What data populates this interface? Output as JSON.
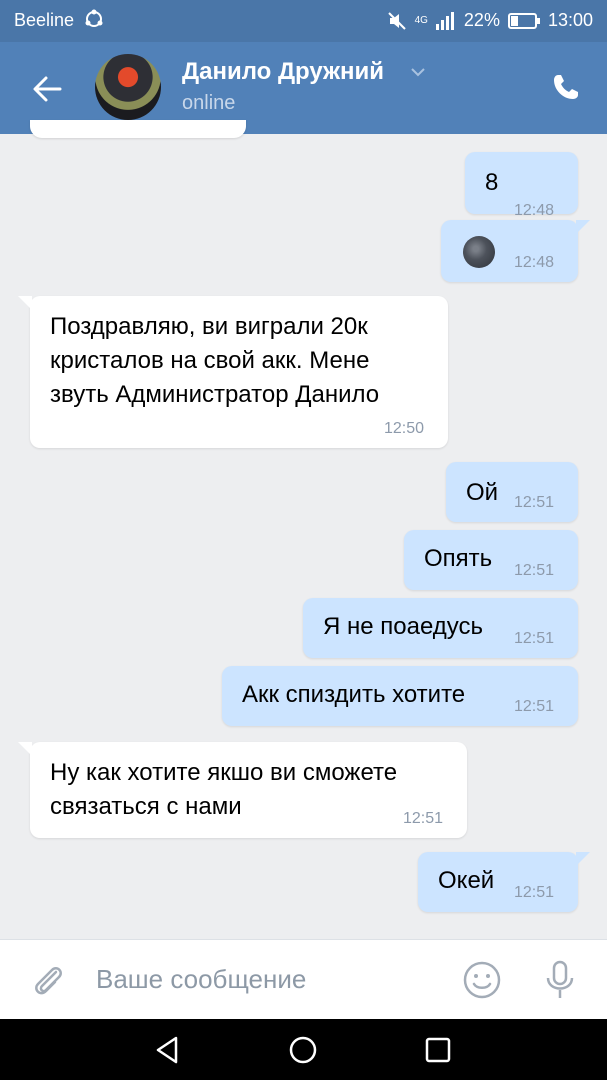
{
  "status_bar": {
    "carrier": "Beeline",
    "network": "4G",
    "battery": "22%",
    "time": "13:00"
  },
  "header": {
    "contact_name": "Данило Дружний",
    "presence": "online"
  },
  "messages": [
    {
      "direction": "out",
      "text": "8",
      "time": "12:48"
    },
    {
      "direction": "out",
      "text": "",
      "emoji": "new-moon-face",
      "time": "12:48"
    },
    {
      "direction": "in",
      "text": "Поздравляю, ви виграли 20к\nкристалов на свой акк. Мене\nзвуть Администратор Данило",
      "time": "12:50"
    },
    {
      "direction": "out",
      "text": "Ой",
      "time": "12:51"
    },
    {
      "direction": "out",
      "text": "Опять",
      "time": "12:51"
    },
    {
      "direction": "out",
      "text": "Я не поаедусь",
      "time": "12:51"
    },
    {
      "direction": "out",
      "text": "Акк спиздить хотите",
      "time": "12:51"
    },
    {
      "direction": "in",
      "text": "Ну как хотите якшо ви сможете\nсвязаться с нами",
      "time": "12:51"
    },
    {
      "direction": "out",
      "text": "Окей",
      "time": "12:51"
    }
  ],
  "composer": {
    "placeholder": "Ваше сообщение"
  },
  "icons": {
    "back": "arrow-left-icon",
    "call": "phone-icon",
    "attach": "paperclip-icon",
    "emoji": "smile-icon",
    "voice": "microphone-icon"
  },
  "colors": {
    "header": "#5181b8",
    "outgoing_bubble": "#cce4ff",
    "incoming_bubble": "#ffffff",
    "background": "#edeef0"
  }
}
